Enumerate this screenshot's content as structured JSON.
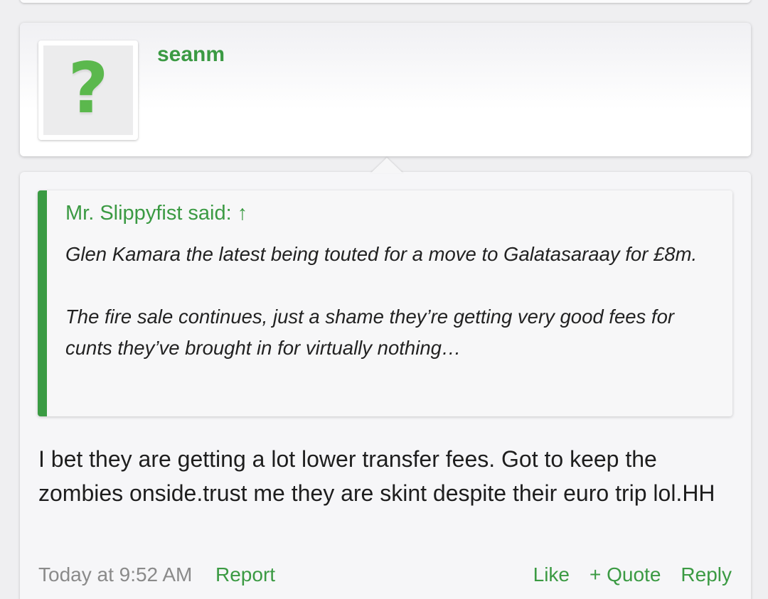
{
  "post": {
    "username": "seanm",
    "avatar_placeholder": "?",
    "quote": {
      "attribution": "Mr. Slippyfist said: ↑",
      "paragraphs": [
        "Glen Kamara the latest being touted for a move to Galatasaraay for £8m.",
        "The fire sale continues, just a shame they’re getting very good fees for cunts they’ve brought in for virtually nothing…"
      ]
    },
    "body": "I bet they are getting a lot lower transfer fees. Got to keep the zombies onside.trust me they are skint despite their euro trip lol.HH",
    "footer": {
      "timestamp": "Today at 9:52 AM",
      "report": "Report",
      "like": "Like",
      "quote": "+ Quote",
      "reply": "Reply"
    }
  },
  "colors": {
    "accent": "#3b9a43",
    "quote_bar": "#3a9b43",
    "avatar_icon": "#5bb84d",
    "muted": "#8a8a8a"
  },
  "icons": {
    "avatar": "question-mark-icon"
  }
}
